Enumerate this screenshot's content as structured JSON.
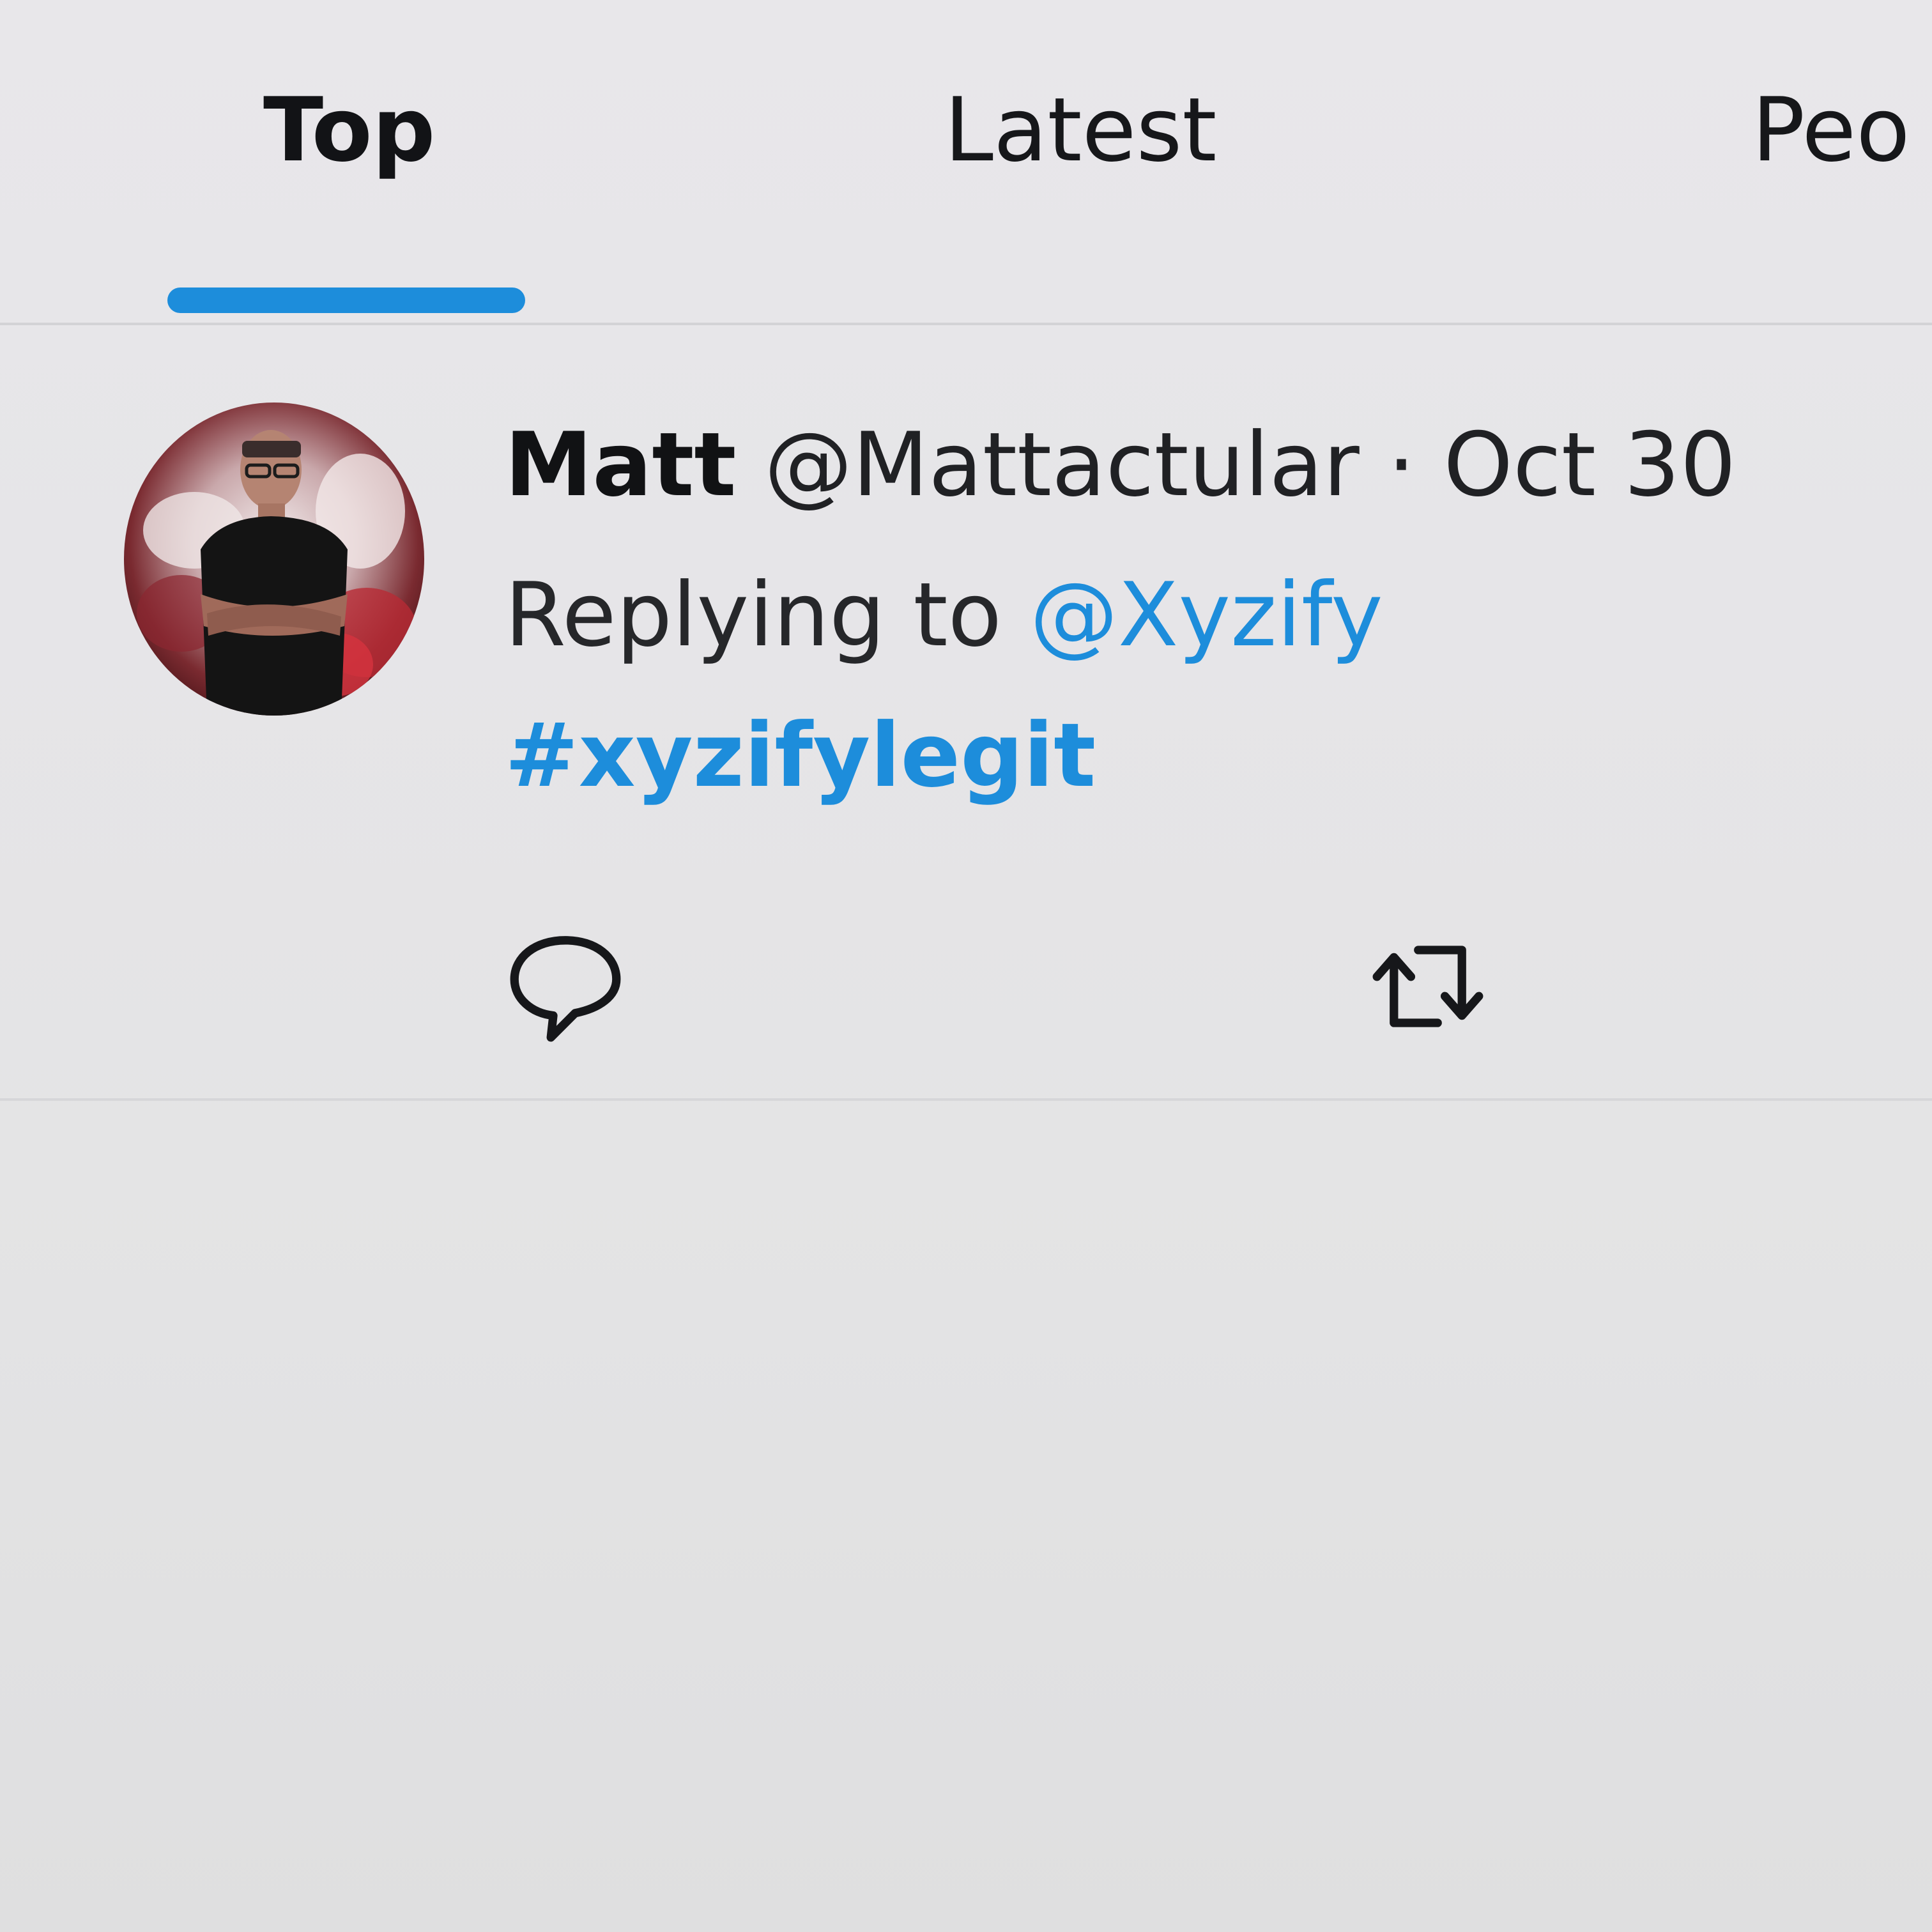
{
  "tabs": [
    {
      "label": "Top",
      "selected": true
    },
    {
      "label": "Latest",
      "selected": false
    },
    {
      "label": "Peo",
      "selected": false
    }
  ],
  "tweet": {
    "author_name": "Matt",
    "handle": "@Mattactular",
    "separator": "·",
    "date": "Oct 30",
    "replying_prefix": "Replying to",
    "replying_to": "@Xyzify",
    "hashtag": "#xyzifylegit",
    "actions": {
      "reply_icon": "speech-bubble",
      "retweet_icon": "retweet-arrows"
    }
  },
  "colors": {
    "accent": "#1d8ddb",
    "text": "#111214",
    "background": "#e6e5e8"
  }
}
